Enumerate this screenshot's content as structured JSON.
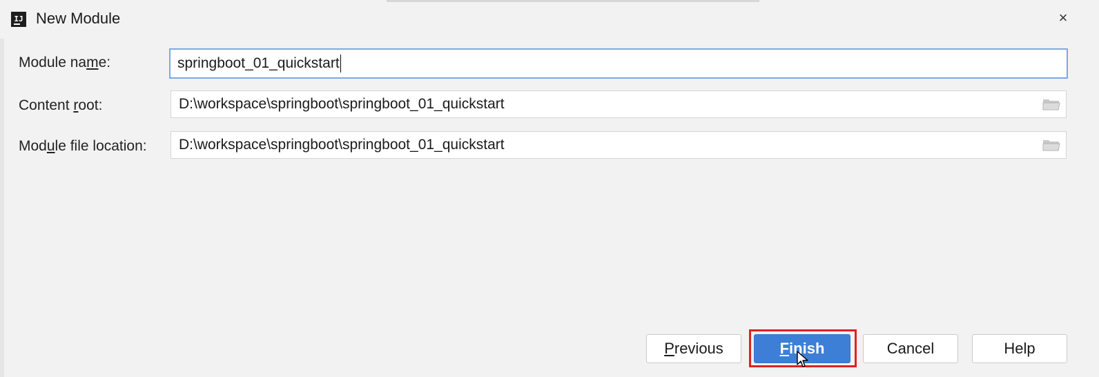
{
  "window": {
    "title": "New Module",
    "app_icon_text": "IJ",
    "close_symbol": "×"
  },
  "form": {
    "module_name": {
      "label_before": "Module na",
      "label_mnemonic": "m",
      "label_after": "e:",
      "value": "springboot_01_quickstart"
    },
    "content_root": {
      "label_before": "Content ",
      "label_mnemonic": "r",
      "label_after": "oot:",
      "value": "D:\\workspace\\springboot\\springboot_01_quickstart",
      "browse_icon": "folder-icon"
    },
    "module_file_location": {
      "label_before": "Mod",
      "label_mnemonic": "u",
      "label_after": "le file location:",
      "value": "D:\\workspace\\springboot\\springboot_01_quickstart",
      "browse_icon": "folder-icon"
    }
  },
  "buttons": {
    "previous": {
      "mnemonic": "P",
      "rest": "revious"
    },
    "finish": {
      "mnemonic": "F",
      "rest": "inish"
    },
    "cancel": "Cancel",
    "help": "Help"
  },
  "colors": {
    "primary_button": "#3d7fd6",
    "focus_border": "#7ea7e6",
    "highlight_annotation": "#e02020",
    "background": "#f2f2f2"
  }
}
